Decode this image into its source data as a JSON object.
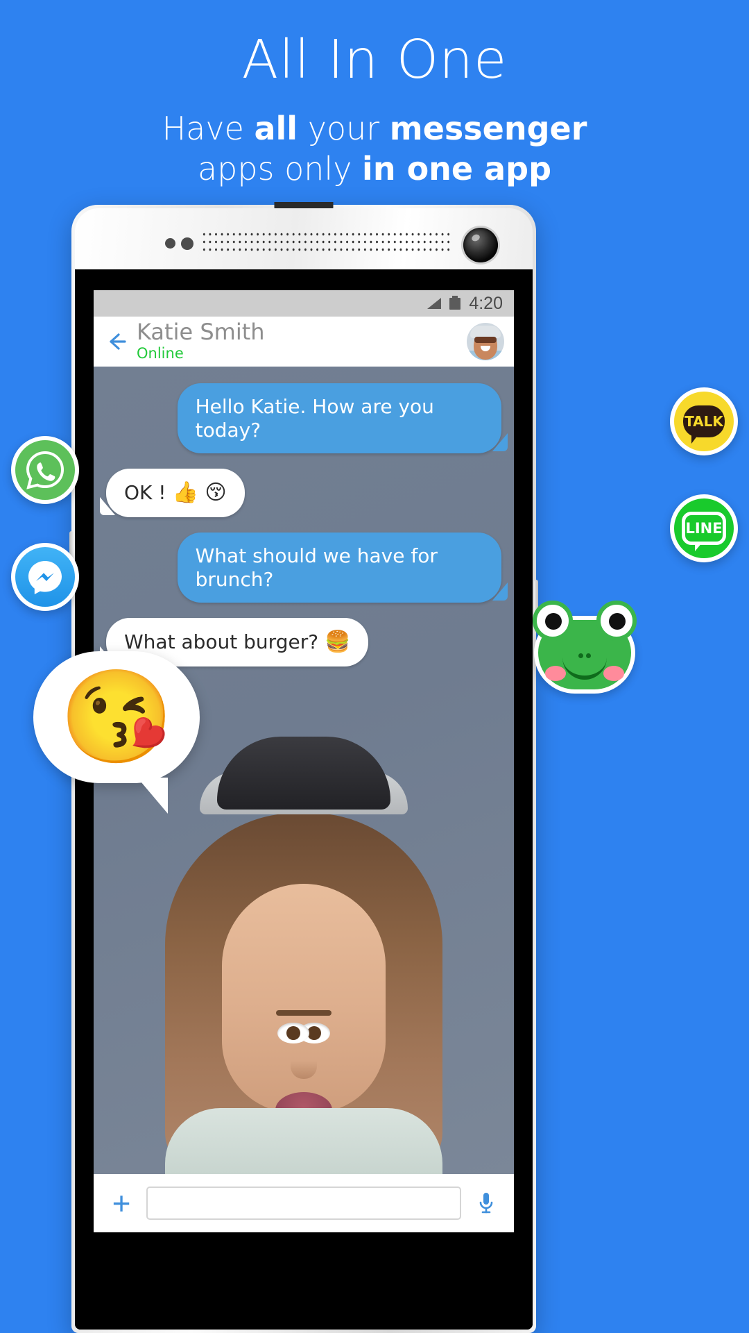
{
  "promo": {
    "title": "All In One",
    "subtitle_line1_pre": "Have ",
    "subtitle_line1_b1": "all",
    "subtitle_line1_mid": " your ",
    "subtitle_line1_b2": "messenger",
    "subtitle_line2_pre": "apps only ",
    "subtitle_line2_b1": "in one app",
    "background_color": "#2e82f0",
    "text_color": "#ffffff"
  },
  "phone": {
    "status_bar": {
      "time": "4:20",
      "signal_icon": "signal-bars-icon",
      "battery_icon": "battery-icon",
      "background_color": "#cdcdcd"
    },
    "chat_header": {
      "back_icon": "back-arrow-icon",
      "contact_name": "Katie Smith",
      "status": "Online",
      "status_color": "#22c93a",
      "avatar_icon": "contact-avatar"
    },
    "messages": [
      {
        "side": "out",
        "text": "Hello Katie. How are you today?"
      },
      {
        "side": "in",
        "text": "OK !",
        "emoji": "👍 😚"
      },
      {
        "side": "out",
        "text": "What should we have for brunch?"
      },
      {
        "side": "in",
        "text": "What about burger?",
        "emoji": "🍔"
      }
    ],
    "input_bar": {
      "add_label": "+",
      "placeholder": "",
      "value": "",
      "mic_icon": "microphone-icon"
    },
    "bubble_out_color": "#4a9fe0",
    "bubble_in_color": "#ffffff"
  },
  "app_icons": [
    {
      "name": "whatsapp",
      "label": "",
      "color": "#5dc05a"
    },
    {
      "name": "messenger",
      "label": "",
      "color": "#1f93e8"
    },
    {
      "name": "kakaotalk",
      "label": "TALK",
      "color": "#f7d92b"
    },
    {
      "name": "line",
      "label": "LINE",
      "color": "#19ca2c"
    }
  ],
  "stickers": {
    "emoji_bubble": "😘",
    "frog_sticker": "frog-sticker"
  }
}
